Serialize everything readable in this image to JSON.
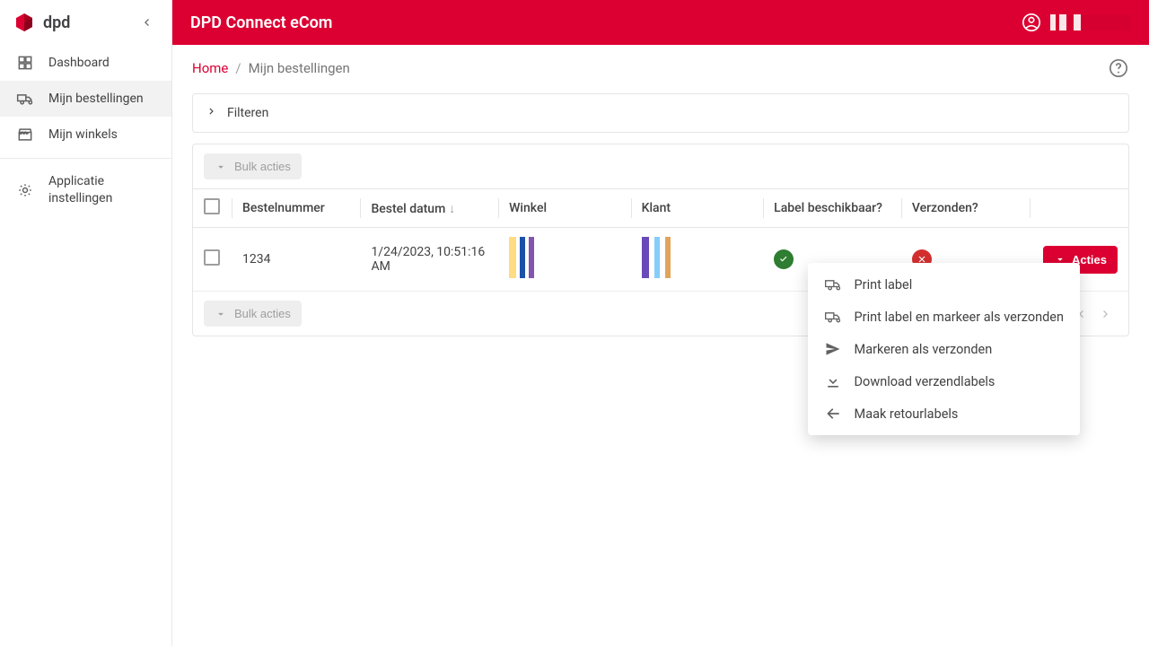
{
  "brand": {
    "name": "dpd",
    "accent": "#DC0032"
  },
  "app_title": "DPD Connect eCom",
  "sidebar": {
    "items": [
      {
        "label": "Dashboard",
        "icon": "dashboard"
      },
      {
        "label": "Mijn bestellingen",
        "icon": "truck",
        "active": true
      },
      {
        "label": "Mijn winkels",
        "icon": "store"
      },
      {
        "label": "Applicatie instellingen",
        "icon": "settings"
      }
    ]
  },
  "breadcrumb": {
    "home": "Home",
    "current": "Mijn bestellingen"
  },
  "filter": {
    "label": "Filteren"
  },
  "bulk_actions_label": "Bulk acties",
  "columns": {
    "order": "Bestelnummer",
    "date": "Bestel datum",
    "shop": "Winkel",
    "customer": "Klant",
    "label_available": "Label beschikbaar?",
    "sent": "Verzonden?"
  },
  "rows": [
    {
      "order": "1234",
      "date": "1/24/2023, 10:51:16 AM",
      "label_available": true,
      "sent": false
    }
  ],
  "actions_button": "Acties",
  "actions_menu": [
    {
      "label": "Print label",
      "icon": "truck"
    },
    {
      "label": "Print label en markeer als verzonden",
      "icon": "truck"
    },
    {
      "label": "Markeren als verzonden",
      "icon": "send"
    },
    {
      "label": "Download verzendlabels",
      "icon": "download"
    },
    {
      "label": "Maak retourlabels",
      "icon": "arrow-left"
    }
  ]
}
